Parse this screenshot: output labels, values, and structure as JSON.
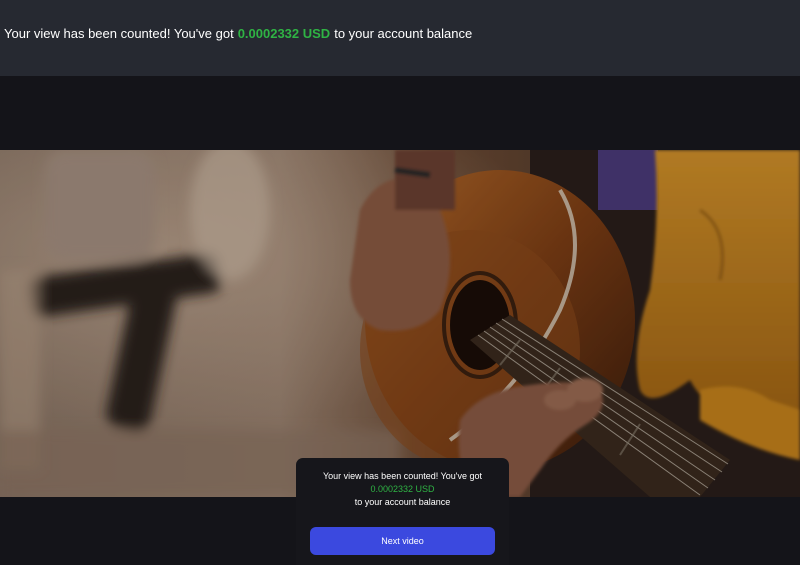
{
  "banner": {
    "text_before": "Your view has been counted! You've got ",
    "amount": "0.0002332 USD",
    "text_after": " to your account balance"
  },
  "popup": {
    "line1": "Your view has been counted! You've got",
    "amount": "0.0002332 USD",
    "line3": "to your account balance",
    "button_label": "Next video"
  },
  "colors": {
    "accent_green": "#2fb344",
    "button_blue": "#3b49df",
    "banner_bg": "#262931",
    "page_bg": "#131318"
  }
}
